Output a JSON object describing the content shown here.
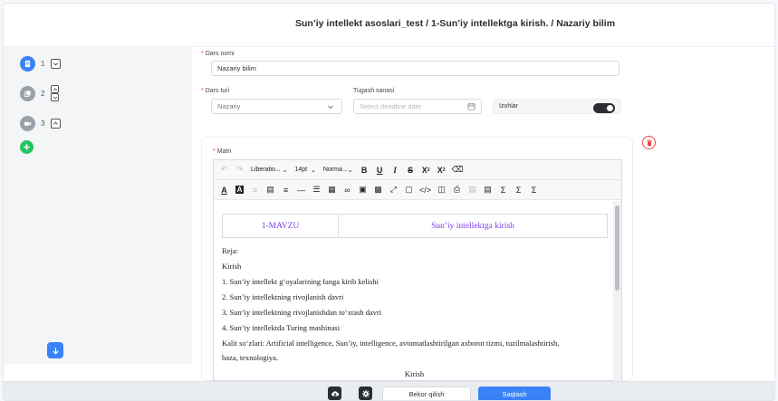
{
  "header": {
    "title": "Sun’iy intellekt asoslari_test / 1-Sun’iy intellektga kirish. / Nazariy bilim"
  },
  "sidebar": {
    "items": [
      {
        "num": "1",
        "type": "document-icon",
        "state": "active"
      },
      {
        "num": "2",
        "type": "copy-icon",
        "state": "inactive"
      },
      {
        "num": "3",
        "type": "video-icon",
        "state": "inactive"
      }
    ]
  },
  "form": {
    "name_label": "Dars nomi",
    "name_value": "Nazariy bilim",
    "type_label": "Dars turi",
    "type_value": "Nazariy",
    "deadline_label": "Tugash sanasi",
    "deadline_placeholder": "Select deadline date",
    "comments_label": "Izohlar",
    "comments_enabled": true
  },
  "editor": {
    "label": "Matn",
    "toolbar": {
      "font_family": "Liberatio...",
      "font_size": "14pt",
      "block_format": "Norma..."
    },
    "content": {
      "table": {
        "left": "1-MAVZU",
        "right": "Sun’iy intellektga kirish"
      },
      "plan_heading": "Reja:",
      "intro": "Kirish",
      "plan_items": [
        "1.  Sun’iy intellekt g‘oyalarining fanga kirib kelishi",
        "2.  Sun’iy intellektning rivojlanish davri",
        "3.  Sun’iy intellektning rivojlanishdan to‘xtash davri",
        "4.  Sun’iy intellektda Turing mashinasi"
      ],
      "keywords_line1": "Kalit so‘zlari: Artificial intelligence, Sun’iy, intelligence, avtomatlashtirilgan axborot tizmi, tuzilmalashtirish,",
      "keywords_line2": "baza, texnologiya.",
      "section_heading": "Kirish"
    }
  },
  "footer": {
    "cancel_label": "Bekor qilish",
    "save_label": "Saqlash"
  },
  "colors": {
    "accent": "#3b82f6",
    "add": "#22c55e",
    "danger": "#ef4444",
    "link": "#7c3aed"
  }
}
